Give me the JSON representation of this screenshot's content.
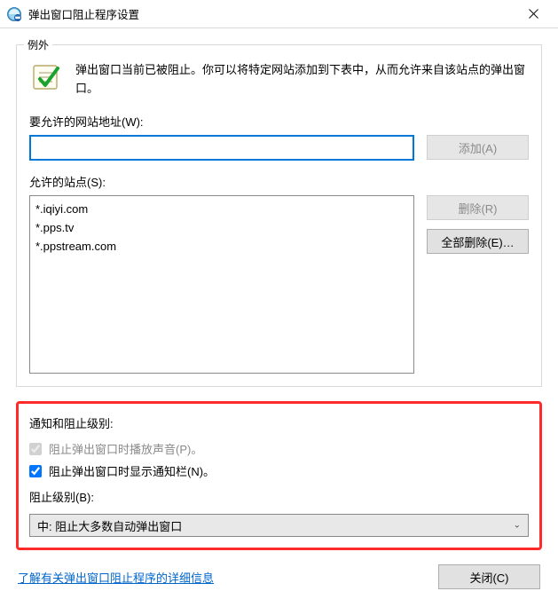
{
  "window": {
    "title": "弹出窗口阻止程序设置"
  },
  "exceptions": {
    "legend": "例外",
    "intro": "弹出窗口当前已被阻止。你可以将特定网站添加到下表中，从而允许来自该站点的弹出窗口。",
    "address_label": "要允许的网站地址(W):",
    "address_value": "",
    "add_btn": "添加(A)",
    "allowed_label": "允许的站点(S):",
    "allowed_sites": [
      "*.iqiyi.com",
      "*.pps.tv",
      "*.ppstream.com"
    ],
    "remove_btn": "删除(R)",
    "remove_all_btn": "全部删除(E)…"
  },
  "notifications": {
    "heading": "通知和阻止级别:",
    "play_sound_label": "阻止弹出窗口时播放声音(P)。",
    "play_sound_checked": true,
    "show_bar_label": "阻止弹出窗口时显示通知栏(N)。",
    "show_bar_checked": true,
    "level_label": "阻止级别(B):",
    "level_value": "中: 阻止大多数自动弹出窗口"
  },
  "footer": {
    "more_info": "了解有关弹出窗口阻止程序的详细信息",
    "close_btn": "关闭(C)"
  }
}
